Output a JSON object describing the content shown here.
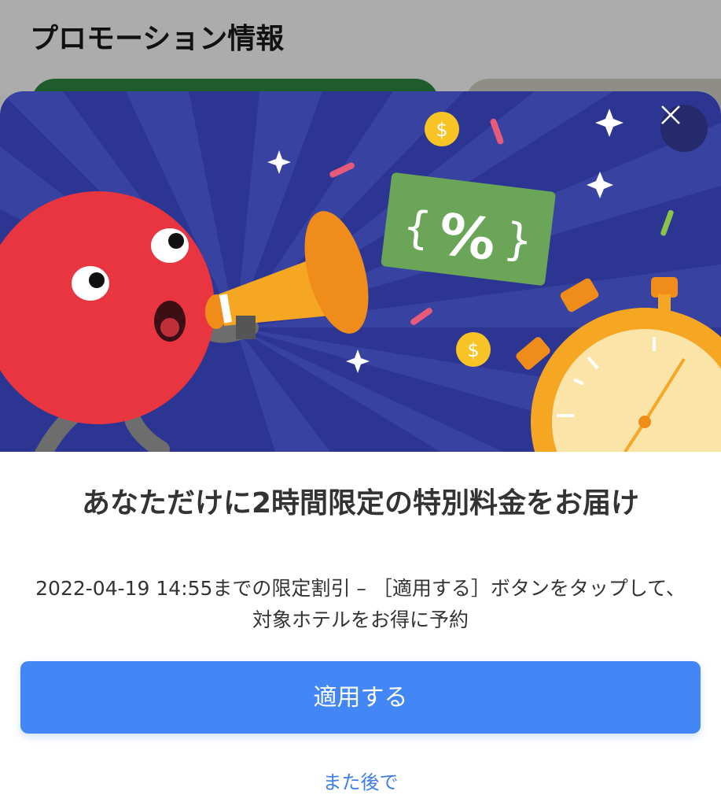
{
  "background": {
    "title": "プロモーション情報"
  },
  "modal": {
    "close_icon": "close-icon",
    "hero_icons": [
      "megaphone-icon",
      "percent-coupon-icon",
      "stopwatch-icon",
      "dollar-coin-icon",
      "sparkle-icon"
    ],
    "headline": "あなただけに2時間限定の特別料金をお届け",
    "description": "2022-04-19 14:55までの限定割引 – ［適用する］ボタンをタップして、対象ホテルをお得に予約",
    "apply_label": "適用する",
    "later_label": "また後で"
  },
  "colors": {
    "hero_bg": "#2c3591",
    "primary_button": "#4287f5",
    "link": "#3d7ee6",
    "mascot_red": "#e8353f",
    "coupon_green": "#6aa558",
    "stopwatch_orange": "#f5a623"
  }
}
